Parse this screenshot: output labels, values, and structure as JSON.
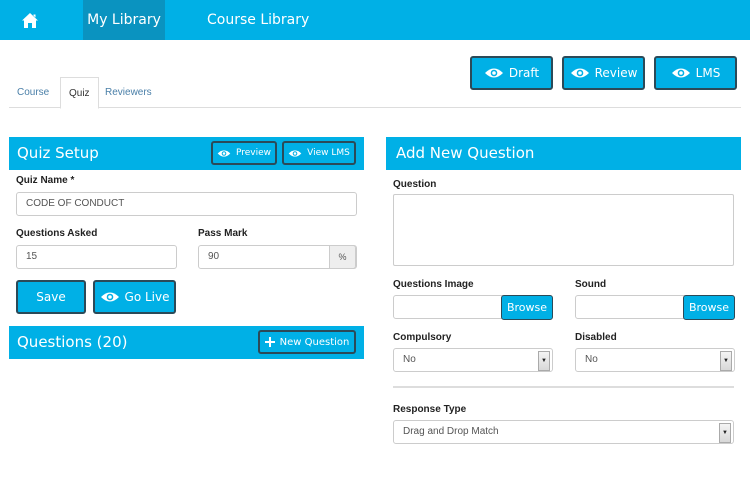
{
  "nav": {
    "home_icon": "home-icon",
    "items": [
      {
        "label": "My Library",
        "active": true
      },
      {
        "label": "Course Library",
        "active": false
      }
    ],
    "bar_color": "#00b0e6",
    "active_color": "#0a93c0"
  },
  "tabs": [
    {
      "label": "Course",
      "active": false
    },
    {
      "label": "Quiz",
      "active": true
    },
    {
      "label": "Reviewers",
      "active": false
    }
  ],
  "top_actions": [
    {
      "label": "Draft",
      "icon": "eye-icon"
    },
    {
      "label": "Review",
      "icon": "eye-icon"
    },
    {
      "label": "LMS",
      "icon": "eye-icon"
    }
  ],
  "quiz_setup": {
    "title": "Quiz Setup",
    "preview_label": "Preview",
    "view_lms_label": "View LMS",
    "quiz_name_label": "Quiz Name *",
    "quiz_name_value": "CODE OF CONDUCT",
    "questions_asked_label": "Questions Asked",
    "questions_asked_value": "15",
    "pass_mark_label": "Pass Mark",
    "pass_mark_value": "90",
    "pass_mark_unit": "%",
    "save_label": "Save",
    "go_live_label": "Go Live"
  },
  "questions": {
    "title": "Questions (20)",
    "new_question_label": "New Question"
  },
  "add_question": {
    "title": "Add New Question",
    "question_label": "Question",
    "question_value": "",
    "image_label": "Questions Image",
    "sound_label": "Sound",
    "browse_label": "Browse",
    "compulsory_label": "Compulsory",
    "compulsory_value": "No",
    "disabled_label": "Disabled",
    "disabled_value": "No",
    "response_type_label": "Response Type",
    "response_type_value": "Drag and Drop Match"
  }
}
